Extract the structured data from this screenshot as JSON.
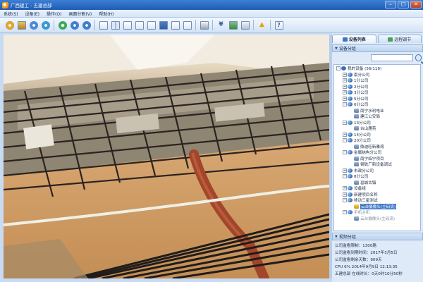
{
  "window": {
    "title": "广西建工 - 五建总部",
    "btn_min": "–",
    "btn_max": "□",
    "btn_close": "✕"
  },
  "menu": [
    "系统(S)",
    "设备(E)",
    "操作(O)",
    "画面分割(V)",
    "帮助(H)"
  ],
  "toolbar_icons": [
    "camera-icon",
    "multi-camera-icon",
    "record-icon",
    "play-icon",
    "refresh-icon",
    "back-icon",
    "forward-icon",
    "split-1-icon",
    "split-4-icon",
    "split-6-icon",
    "split-8-icon",
    "split-9-icon",
    "split-16-icon",
    "fullscreen-icon",
    "snapshot-icon",
    "print-icon",
    "currency-icon",
    "export-icon",
    "download-icon",
    "warning-icon",
    "help-icon"
  ],
  "tabs": {
    "devices": "设备列表",
    "remote": "远程调节"
  },
  "panels": {
    "group_header": "设备分组",
    "info_header": "视频分组"
  },
  "tree": [
    {
      "level": 0,
      "exp": "−",
      "icon": "root",
      "label": "我的设备 (56/116)"
    },
    {
      "level": 1,
      "exp": "+",
      "icon": "group",
      "label": "南分公司"
    },
    {
      "level": 1,
      "exp": "+",
      "icon": "group",
      "label": "1分公司"
    },
    {
      "level": 1,
      "exp": "+",
      "icon": "group",
      "label": "2分公司"
    },
    {
      "level": 1,
      "exp": "+",
      "icon": "group",
      "label": "3分公司"
    },
    {
      "level": 1,
      "exp": "+",
      "icon": "group",
      "label": "5分公司"
    },
    {
      "level": 1,
      "exp": "−",
      "icon": "group",
      "label": "6分公司"
    },
    {
      "level": 2,
      "exp": "",
      "icon": "cam",
      "label": "南宁水利电业"
    },
    {
      "level": 2,
      "exp": "",
      "icon": "cam",
      "label": "建江公安局"
    },
    {
      "level": 1,
      "exp": "−",
      "icon": "group",
      "label": "13分公司"
    },
    {
      "level": 2,
      "exp": "",
      "icon": "cam",
      "label": "古山雁苑"
    },
    {
      "level": 1,
      "exp": "+",
      "icon": "group",
      "label": "14分公司"
    },
    {
      "level": 1,
      "exp": "−",
      "icon": "group",
      "label": "20分公司"
    },
    {
      "level": 2,
      "exp": "",
      "icon": "cam",
      "label": "鼎迪旺新雅湾"
    },
    {
      "level": 1,
      "exp": "−",
      "icon": "group",
      "label": "金属结构分公司"
    },
    {
      "level": 2,
      "exp": "",
      "icon": "cam",
      "label": "南宁临宁项目"
    },
    {
      "level": 2,
      "exp": "",
      "icon": "cam",
      "label": "钢铁厂新设备调试"
    },
    {
      "level": 1,
      "exp": "+",
      "icon": "group",
      "label": "市政分公司"
    },
    {
      "level": 1,
      "exp": "−",
      "icon": "group",
      "label": "8分公司"
    },
    {
      "level": 2,
      "exp": "",
      "icon": "cam",
      "label": "邕城古镇"
    },
    {
      "level": 1,
      "exp": "+",
      "icon": "group",
      "label": "设备组"
    },
    {
      "level": 1,
      "exp": "+",
      "icon": "group",
      "label": "新建项目名称"
    },
    {
      "level": 1,
      "exp": "−",
      "icon": "group",
      "label": "移动三星测试"
    },
    {
      "level": 2,
      "exp": "",
      "icon": "cam-y",
      "label": "云台摄像头(主码流)",
      "selected": true
    },
    {
      "level": 1,
      "exp": "−",
      "icon": "group",
      "label": "手机主机",
      "dim": true
    },
    {
      "level": 2,
      "exp": "",
      "icon": "cam",
      "label": "云台摄像头(主码流)",
      "dim": true
    }
  ],
  "info_lines": [
    "公司监看限制：1300路",
    "公司监看到期时间：2017年3月5日",
    "公司监看剩余天数：909天",
    "CPU 6%   2014年9月9日 12:13:35",
    "五建总部  在线时长：0天0时10分50秒"
  ],
  "accent": "#3c78c8"
}
